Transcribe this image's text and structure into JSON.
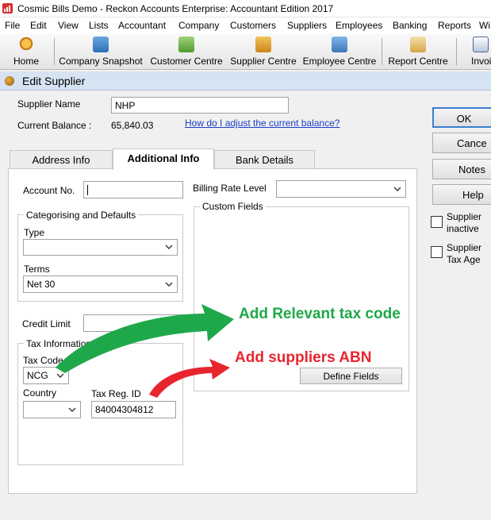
{
  "app": {
    "title": "Cosmic Bills Demo - Reckon Accounts Enterprise: Accountant Edition 2017"
  },
  "menu": [
    "File",
    "Edit",
    "View",
    "Lists",
    "Accountant",
    "Company",
    "Customers",
    "Suppliers",
    "Employees",
    "Banking",
    "Reports",
    "Wi"
  ],
  "toolbar": {
    "home": "Home",
    "company_snapshot": "Company Snapshot",
    "customer_centre": "Customer Centre",
    "supplier_centre": "Supplier Centre",
    "employee_centre": "Employee Centre",
    "report_centre": "Report Centre",
    "invoice": "Invoi"
  },
  "window": {
    "title": "Edit Supplier"
  },
  "supplier": {
    "name_label": "Supplier Name",
    "name_value": "NHP",
    "balance_label": "Current Balance :",
    "balance_value": "65,840.03",
    "adjust_link": "How do I adjust the current balance?"
  },
  "tabs": [
    "Address Info",
    "Additional Info",
    "Bank Details"
  ],
  "additional": {
    "account_no_label": "Account No.",
    "account_no_value": "",
    "billing_rate_label": "Billing Rate Level",
    "billing_rate_value": "",
    "custom_fields_title": "Custom Fields",
    "define_fields_button": "Define Fields",
    "categorising_title": "Categorising and Defaults",
    "type_label": "Type",
    "type_value": "",
    "terms_label": "Terms",
    "terms_value": "Net 30",
    "credit_limit_label": "Credit Limit",
    "credit_limit_value": "",
    "tax_info_title": "Tax Information",
    "tax_code_label": "Tax Code",
    "tax_code_value": "NCG",
    "country_label": "Country",
    "country_value": "",
    "tax_reg_label": "Tax Reg. ID",
    "tax_reg_value": "84004304812"
  },
  "buttons": {
    "ok": "OK",
    "cancel": "Cance",
    "notes": "Notes",
    "help": "Help"
  },
  "checkboxes": {
    "inactive_line1": "Supplier",
    "inactive_line2": "inactive",
    "tax_agent_line1": "Supplier",
    "tax_agent_line2": "Tax Age"
  },
  "annotations": {
    "tax_code": "Add Relevant tax code",
    "abn": "Add suppliers ABN",
    "green_color": "#1fa84a",
    "red_color": "#e8252f"
  }
}
